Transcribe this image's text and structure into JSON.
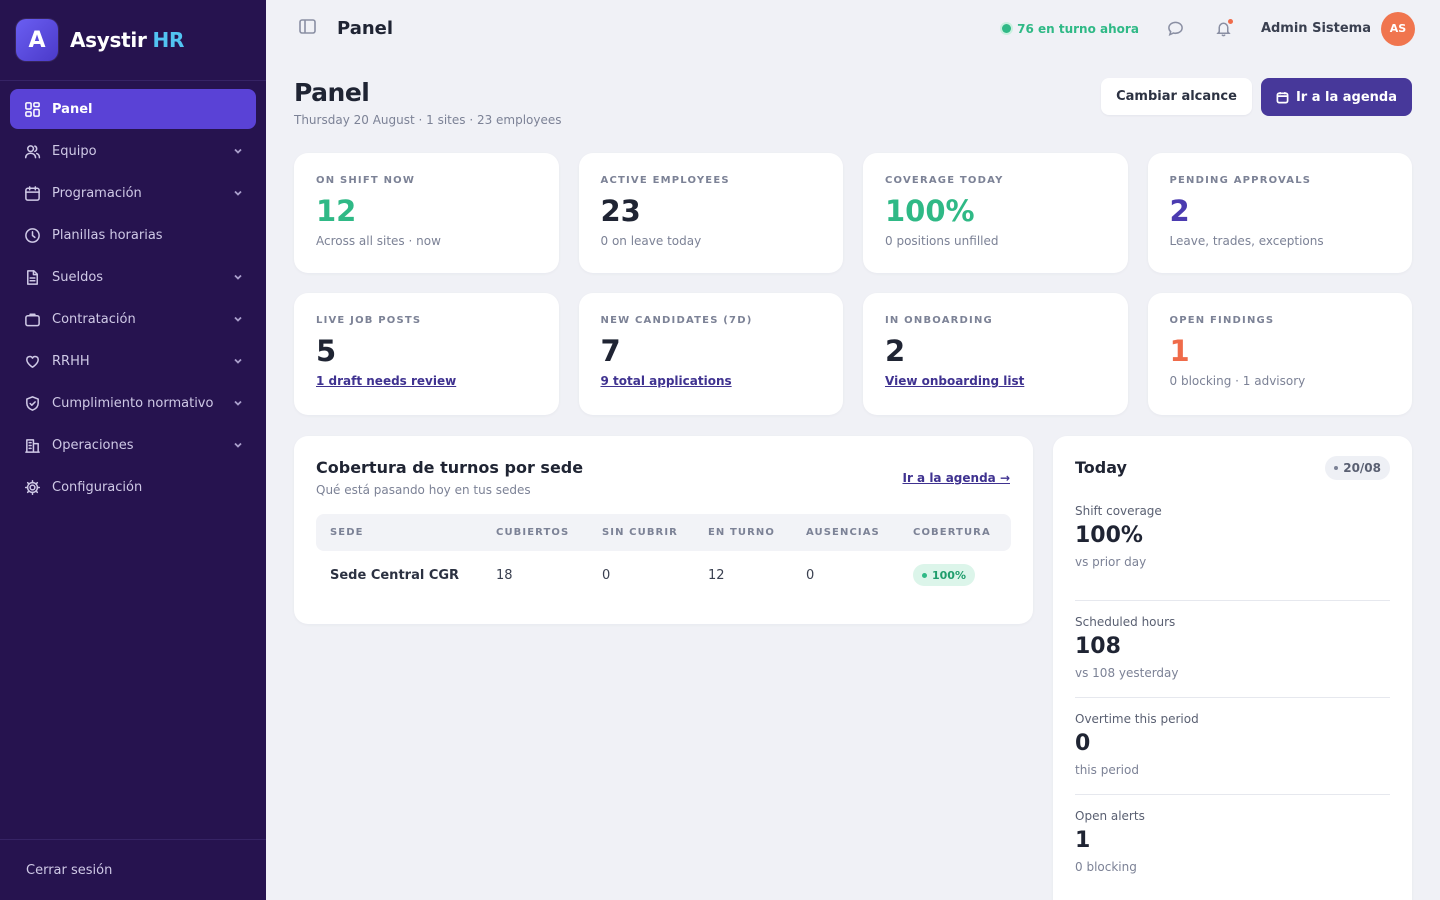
{
  "brand": {
    "letter": "A",
    "name": "Asystir",
    "suffix": "HR"
  },
  "sidebar": {
    "items": [
      {
        "label": "Panel",
        "icon": "grid-icon",
        "active": true,
        "expandable": false
      },
      {
        "label": "Equipo",
        "icon": "users-icon",
        "expandable": true
      },
      {
        "label": "Programación",
        "icon": "calendar-icon",
        "expandable": true
      },
      {
        "label": "Planillas horarias",
        "icon": "clock-icon",
        "expandable": false
      },
      {
        "label": "Sueldos",
        "icon": "document-icon",
        "expandable": true
      },
      {
        "label": "Contratación",
        "icon": "briefcase-icon",
        "expandable": true
      },
      {
        "label": "RRHH",
        "icon": "heart-icon",
        "expandable": true
      },
      {
        "label": "Cumplimiento normativo",
        "icon": "shield-icon",
        "expandable": true
      },
      {
        "label": "Operaciones",
        "icon": "building-icon",
        "expandable": true
      },
      {
        "label": "Configuración",
        "icon": "gear-icon",
        "expandable": false
      }
    ],
    "logout": "Cerrar sesión"
  },
  "topbar": {
    "title": "Panel",
    "on_shift": "76 en turno ahora",
    "user_name": "Admin Sistema",
    "user_initials": "AS"
  },
  "header": {
    "title": "Panel",
    "subtitle": "Thursday 20 August · 1 sites · 23 employees",
    "scope_button": "Cambiar alcance",
    "agenda_button": "Ir a la agenda"
  },
  "stats_row1": [
    {
      "label": "ON SHIFT NOW",
      "value": "12",
      "note": "Across all sites · now",
      "color": "#2fb986"
    },
    {
      "label": "ACTIVE EMPLOYEES",
      "value": "23",
      "note": "0 on leave today",
      "color": "#1f2433"
    },
    {
      "label": "COVERAGE TODAY",
      "value": "100%",
      "note": "0 positions unfilled",
      "color": "#2fb986"
    },
    {
      "label": "PENDING APPROVALS",
      "value": "2",
      "note": "Leave, trades, exceptions",
      "color": "#4b3bb0"
    }
  ],
  "stats_row2": [
    {
      "label": "LIVE JOB POSTS",
      "value": "5",
      "link": "1 draft needs review"
    },
    {
      "label": "NEW CANDIDATES (7D)",
      "value": "7",
      "link": "9 total applications"
    },
    {
      "label": "IN ONBOARDING",
      "value": "2",
      "link": "View onboarding list"
    },
    {
      "label": "OPEN FINDINGS",
      "value": "1",
      "note": "0 blocking · 1 advisory",
      "color": "#ef6b4a"
    }
  ],
  "coverage": {
    "title": "Cobertura de turnos por sede",
    "subtitle": "Qué está pasando hoy en tus sedes",
    "link": "Ir a la agenda →",
    "columns": [
      "SEDE",
      "CUBIERTOS",
      "SIN CUBRIR",
      "EN TURNO",
      "AUSENCIAS",
      "COBERTURA"
    ],
    "rows": [
      {
        "site": "Sede Central CGR",
        "covered": "18",
        "uncovered": "0",
        "on_shift": "12",
        "absences": "0",
        "coverage": "100%"
      }
    ]
  },
  "today": {
    "title": "Today",
    "date": "20/08",
    "metrics": [
      {
        "label": "Shift coverage",
        "value": "100%",
        "note": "vs prior day"
      },
      {
        "label": "Scheduled hours",
        "value": "108",
        "note": "vs 108 yesterday"
      },
      {
        "label": "Overtime this period",
        "value": "0",
        "note": "this period"
      },
      {
        "label": "Open alerts",
        "value": "1",
        "note": "0 blocking"
      }
    ]
  }
}
